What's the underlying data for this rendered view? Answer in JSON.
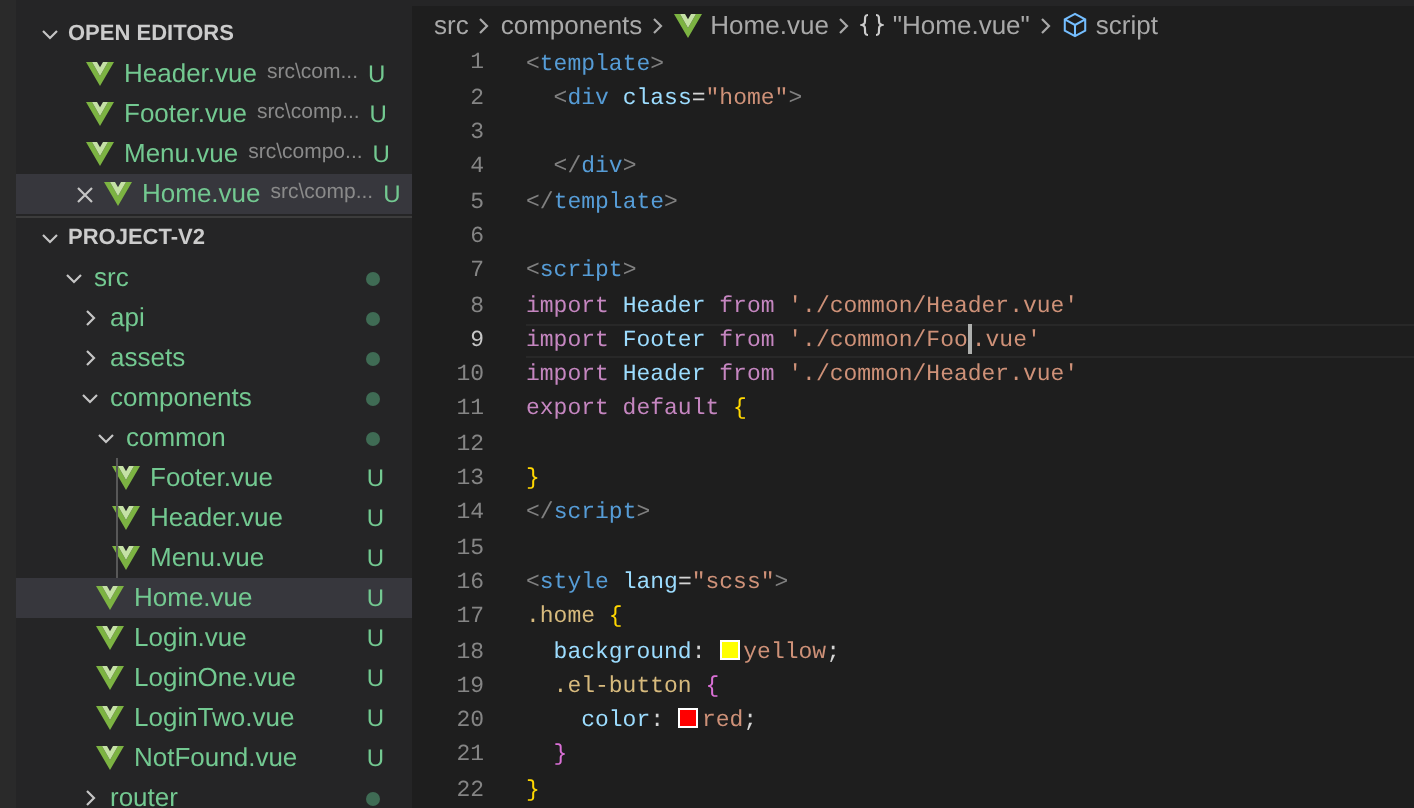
{
  "open_editors": {
    "title": "OPEN EDITORS",
    "expanded": true,
    "items": [
      {
        "name": "Header.vue",
        "path": "src\\com...",
        "badge": "U",
        "selected": false,
        "closable": false
      },
      {
        "name": "Footer.vue",
        "path": "src\\comp...",
        "badge": "U",
        "selected": false,
        "closable": false
      },
      {
        "name": "Menu.vue",
        "path": "src\\compo...",
        "badge": "U",
        "selected": false,
        "closable": false
      },
      {
        "name": "Home.vue",
        "path": "src\\comp...",
        "badge": "U",
        "selected": true,
        "closable": true
      }
    ]
  },
  "project": {
    "title": "PROJECT-V2",
    "expanded": true,
    "tree": [
      {
        "name": "src",
        "kind": "folder",
        "expanded": true,
        "dot": true,
        "selected": false,
        "children": [
          {
            "name": "api",
            "kind": "folder",
            "expanded": false,
            "dot": true,
            "selected": false
          },
          {
            "name": "assets",
            "kind": "folder",
            "expanded": false,
            "dot": true,
            "selected": false
          },
          {
            "name": "components",
            "kind": "folder",
            "expanded": true,
            "dot": true,
            "selected": false,
            "children": [
              {
                "name": "common",
                "kind": "folder",
                "expanded": true,
                "dot": true,
                "selected": false,
                "children": [
                  {
                    "name": "Footer.vue",
                    "kind": "file",
                    "badge": "U",
                    "selected": false
                  },
                  {
                    "name": "Header.vue",
                    "kind": "file",
                    "badge": "U",
                    "selected": false
                  },
                  {
                    "name": "Menu.vue",
                    "kind": "file",
                    "badge": "U",
                    "selected": false
                  }
                ]
              },
              {
                "name": "Home.vue",
                "kind": "file",
                "badge": "U",
                "selected": true
              },
              {
                "name": "Login.vue",
                "kind": "file",
                "badge": "U",
                "selected": false
              },
              {
                "name": "LoginOne.vue",
                "kind": "file",
                "badge": "U",
                "selected": false
              },
              {
                "name": "LoginTwo.vue",
                "kind": "file",
                "badge": "U",
                "selected": false
              },
              {
                "name": "NotFound.vue",
                "kind": "file",
                "badge": "U",
                "selected": false
              }
            ]
          },
          {
            "name": "router",
            "kind": "folder",
            "expanded": false,
            "dot": true,
            "selected": false
          }
        ]
      }
    ]
  },
  "breadcrumb": [
    {
      "text": "src",
      "kind": "folder"
    },
    {
      "text": "components",
      "kind": "folder"
    },
    {
      "text": "Home.vue",
      "kind": "vue"
    },
    {
      "text": "\"Home.vue\"",
      "kind": "object"
    },
    {
      "text": "script",
      "kind": "module"
    }
  ],
  "editor": {
    "lines": [
      {
        "number": "1",
        "current": false,
        "tokens": [
          {
            "text": "<",
            "kind": "punct"
          },
          {
            "text": "template",
            "kind": "tag"
          },
          {
            "text": ">",
            "kind": "punct"
          }
        ]
      },
      {
        "number": "2",
        "current": false,
        "tokens": [
          {
            "text": "  <",
            "kind": "punct"
          },
          {
            "text": "div",
            "kind": "tag"
          },
          {
            "text": " class",
            "kind": "attr"
          },
          {
            "text": "=",
            "kind": "plain"
          },
          {
            "text": "\"home\"",
            "kind": "string"
          },
          {
            "text": ">",
            "kind": "punct"
          }
        ]
      },
      {
        "number": "3",
        "current": false
      },
      {
        "number": "4",
        "current": false,
        "tokens": [
          {
            "text": "  </",
            "kind": "punct"
          },
          {
            "text": "div",
            "kind": "tag"
          },
          {
            "text": ">",
            "kind": "punct"
          }
        ]
      },
      {
        "number": "5",
        "current": false,
        "tokens": [
          {
            "text": "</",
            "kind": "punct"
          },
          {
            "text": "template",
            "kind": "tag"
          },
          {
            "text": ">",
            "kind": "punct"
          }
        ]
      },
      {
        "number": "6",
        "current": false
      },
      {
        "number": "7",
        "current": false,
        "tokens": [
          {
            "text": "<",
            "kind": "punct"
          },
          {
            "text": "script",
            "kind": "tag"
          },
          {
            "text": ">",
            "kind": "punct"
          }
        ]
      },
      {
        "number": "8",
        "current": false,
        "tokens": [
          {
            "text": "import",
            "kind": "keyword"
          },
          {
            "text": " Header ",
            "kind": "variable"
          },
          {
            "text": "from",
            "kind": "keyword"
          },
          {
            "text": " './common/Header.vue'",
            "kind": "string"
          }
        ]
      },
      {
        "number": "9",
        "current": true,
        "tokens": [
          {
            "text": "import",
            "kind": "keyword"
          },
          {
            "text": " Footer ",
            "kind": "variable"
          },
          {
            "text": "from",
            "kind": "keyword"
          },
          {
            "text": " './common/Foo",
            "kind": "string"
          },
          {
            "kind": "cursor"
          },
          {
            "text": ".vue'",
            "kind": "string"
          }
        ]
      },
      {
        "number": "10",
        "current": false,
        "tokens": [
          {
            "text": "import",
            "kind": "keyword"
          },
          {
            "text": " Header ",
            "kind": "variable"
          },
          {
            "text": "from",
            "kind": "keyword"
          },
          {
            "text": " './common/Header.vue'",
            "kind": "string"
          }
        ]
      },
      {
        "number": "11",
        "current": false,
        "tokens": [
          {
            "text": "export default",
            "kind": "keyword"
          },
          {
            "text": " {",
            "kind": "brace"
          }
        ]
      },
      {
        "number": "12",
        "current": false
      },
      {
        "number": "13",
        "current": false,
        "tokens": [
          {
            "text": "}",
            "kind": "brace"
          }
        ]
      },
      {
        "number": "14",
        "current": false,
        "tokens": [
          {
            "text": "</",
            "kind": "punct"
          },
          {
            "text": "script",
            "kind": "tag"
          },
          {
            "text": ">",
            "kind": "punct"
          }
        ]
      },
      {
        "number": "15",
        "current": false
      },
      {
        "number": "16",
        "current": false,
        "tokens": [
          {
            "text": "<",
            "kind": "punct"
          },
          {
            "text": "style",
            "kind": "tag"
          },
          {
            "text": " lang",
            "kind": "attr"
          },
          {
            "text": "=",
            "kind": "plain"
          },
          {
            "text": "\"scss\"",
            "kind": "string"
          },
          {
            "text": ">",
            "kind": "punct"
          }
        ]
      },
      {
        "number": "17",
        "current": false,
        "tokens": [
          {
            "text": ".home",
            "kind": "selector"
          },
          {
            "text": " {",
            "kind": "brace"
          }
        ]
      },
      {
        "number": "18",
        "current": false,
        "tokens": [
          {
            "text": "  background",
            "kind": "property"
          },
          {
            "text": ": ",
            "kind": "plain"
          },
          {
            "kind": "swatch",
            "color": "#ffff00"
          },
          {
            "text": "yellow",
            "kind": "value"
          },
          {
            "text": ";",
            "kind": "plain"
          }
        ]
      },
      {
        "number": "19",
        "current": false,
        "tokens": [
          {
            "text": "  .el-button",
            "kind": "selector"
          },
          {
            "text": " {",
            "kind": "brace2"
          }
        ]
      },
      {
        "number": "20",
        "current": false,
        "tokens": [
          {
            "text": "    color",
            "kind": "property"
          },
          {
            "text": ": ",
            "kind": "plain"
          },
          {
            "kind": "swatch",
            "color": "#ff0000"
          },
          {
            "text": "red",
            "kind": "value"
          },
          {
            "text": ";",
            "kind": "plain"
          }
        ]
      },
      {
        "number": "21",
        "current": false,
        "tokens": [
          {
            "text": "  }",
            "kind": "brace2"
          }
        ]
      },
      {
        "number": "22",
        "current": false,
        "tokens": [
          {
            "text": "}",
            "kind": "brace"
          }
        ]
      }
    ]
  }
}
